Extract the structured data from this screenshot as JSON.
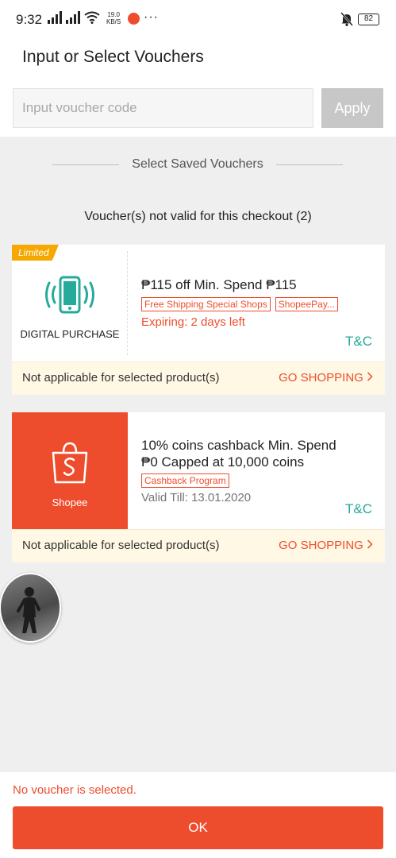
{
  "status_bar": {
    "time": "9:32",
    "net_speed_value": "19.0",
    "net_speed_unit": "KB/S",
    "more": "···",
    "battery": "82"
  },
  "header": {
    "title": "Input or Select Vouchers"
  },
  "voucher_input": {
    "placeholder": "Input voucher code",
    "apply_label": "Apply"
  },
  "saved_section": {
    "label": "Select Saved Vouchers"
  },
  "invalid_section": {
    "title": "Voucher(s) not valid for this checkout (2)"
  },
  "vouchers": [
    {
      "badge": "Limited",
      "icon": "phone-vibrate-icon",
      "left_label": "DIGITAL PURCHASE",
      "title": "₱115 off Min. Spend ₱115",
      "tags": [
        "Free Shipping Special Shops",
        "ShopeePay..."
      ],
      "expiry": "Expiring: 2 days left",
      "tnc": "T&C",
      "footer_note": "Not applicable for selected product(s)",
      "footer_action": "GO SHOPPING"
    },
    {
      "icon": "shopee-bag-icon",
      "left_label": "Shopee",
      "title_line1": "10% coins cashback Min. Spend",
      "title_line2": "₱0 Capped at 10,000 coins",
      "tags": [
        "Cashback Program"
      ],
      "valid_till": "Valid Till: 13.01.2020",
      "tnc": "T&C",
      "footer_note": "Not applicable for selected product(s)",
      "footer_action": "GO SHOPPING"
    }
  ],
  "footer": {
    "status": "No voucher is selected.",
    "ok_label": "OK"
  },
  "colors": {
    "accent": "#ee4d2d",
    "teal": "#26aa99",
    "limited": "#f6a700",
    "note_bg": "#fff8e4"
  }
}
